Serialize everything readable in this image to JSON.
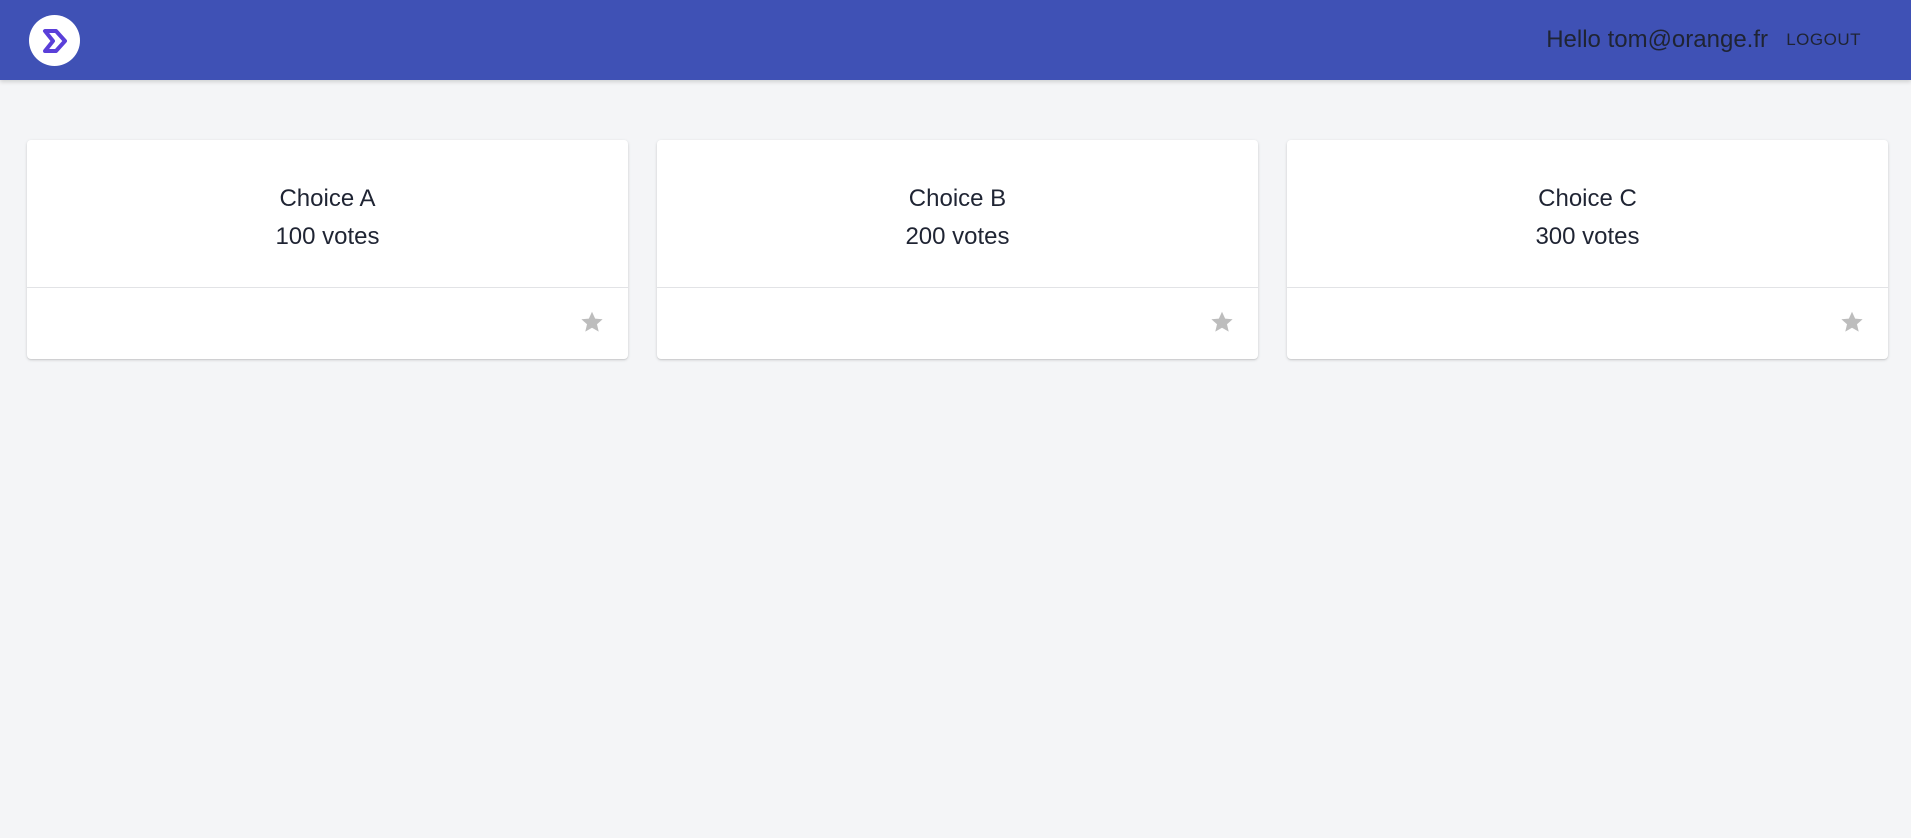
{
  "header": {
    "greeting": "Hello tom@orange.fr",
    "logout_label": "LOGOUT",
    "logo_icon": "brand-chevron-logo",
    "background_color": "#3f51b5",
    "logo_color": "#5a3fd9"
  },
  "choices": [
    {
      "title": "Choice A",
      "votes": "100 votes",
      "action_icon": "star-icon"
    },
    {
      "title": "Choice B",
      "votes": "200 votes",
      "action_icon": "star-icon"
    },
    {
      "title": "Choice C",
      "votes": "300 votes",
      "action_icon": "star-icon"
    }
  ],
  "colors": {
    "page_background": "#f4f5f7",
    "card_background": "#ffffff",
    "star_color": "#bdbdbd",
    "text_color": "#1f2433"
  }
}
